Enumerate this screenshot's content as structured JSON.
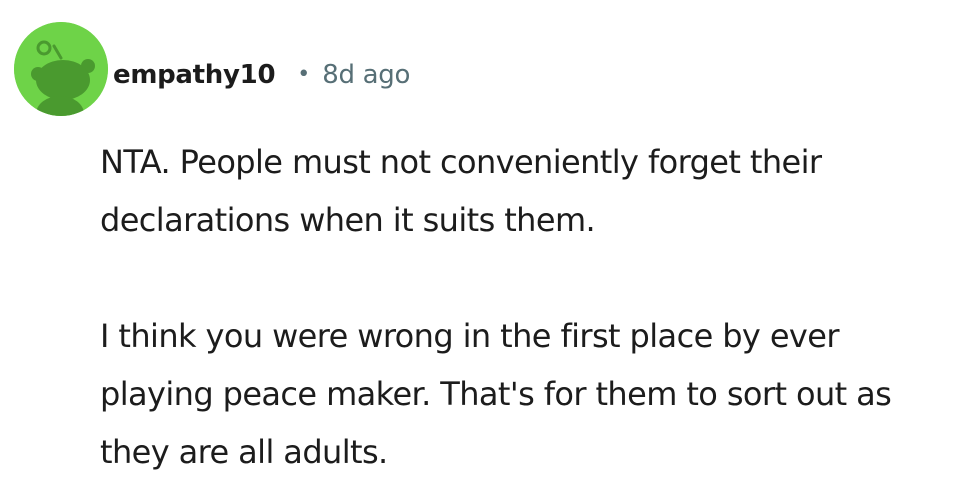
{
  "comment": {
    "author": "empathy10",
    "separator": "•",
    "timestamp": "8d ago",
    "avatar_icon": "snoo-avatar-icon",
    "avatar_color": "#6ed348",
    "paragraphs": [
      "NTA. People must not conveniently forget their declarations when it suits them.",
      "I think you were wrong in the first place by ever playing peace maker. That's for them to sort out as they are all adults."
    ]
  }
}
